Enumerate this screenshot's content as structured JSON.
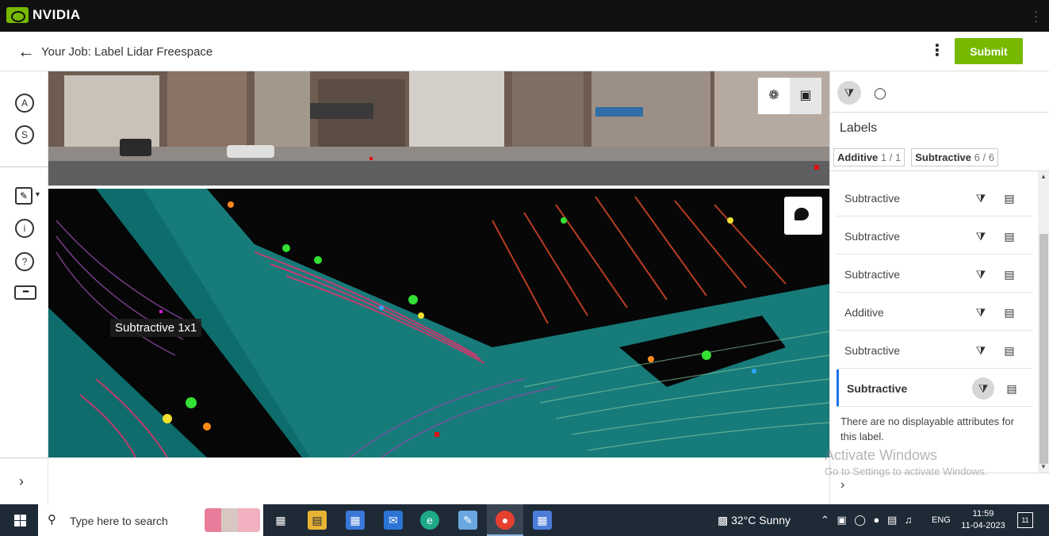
{
  "brand": {
    "name": "NVIDIA"
  },
  "header": {
    "title": "Your Job: Label Lidar Freespace",
    "submit_label": "Submit"
  },
  "rail": {
    "btn_a": "A",
    "btn_s": "S",
    "info": "i",
    "help": "?"
  },
  "lidar": {
    "overlay_label": "Subtractive  1x1"
  },
  "panel": {
    "heading": "Labels",
    "filters": [
      {
        "name": "Additive",
        "count": "1 / 1"
      },
      {
        "name": "Subtractive",
        "count": "6 / 6"
      }
    ],
    "items": [
      {
        "label": "Subtractive"
      },
      {
        "label": "Subtractive"
      },
      {
        "label": "Subtractive"
      },
      {
        "label": "Additive"
      },
      {
        "label": "Subtractive"
      },
      {
        "label": "Subtractive"
      }
    ],
    "no_attributes": "There are no displayable attributes for this label."
  },
  "watermark": {
    "line1": "Activate Windows",
    "line2": "Go to Settings to activate Windows."
  },
  "taskbar": {
    "search_placeholder": "Type here to search",
    "weather": "32°C  Sunny",
    "language": "ENG",
    "time": "11:59",
    "date": "11-04-2023",
    "notifications": "11"
  },
  "colors": {
    "accent": "#76b900",
    "selection": "#1e73e8"
  }
}
